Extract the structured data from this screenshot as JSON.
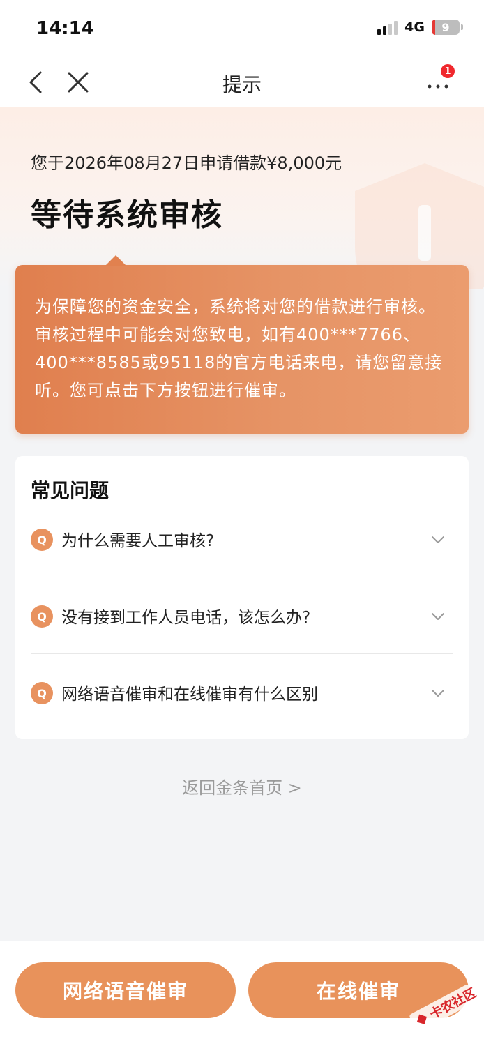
{
  "status_bar": {
    "time": "14:14",
    "network": "4G",
    "battery": "9"
  },
  "nav": {
    "title": "提示",
    "more_badge": "1",
    "icons": [
      "back-icon",
      "close-icon",
      "more-icon"
    ]
  },
  "hero": {
    "subtitle": "您于2026年08月27日申请借款¥8,000元",
    "title": "等待系统审核"
  },
  "notice": {
    "text": "为保障您的资金安全，系统将对您的借款进行审核。审核过程中可能会对您致电，如有400***7766、400***8585或95118的官方电话来电，请您留意接听。您可点击下方按钮进行催审。"
  },
  "faq": {
    "title": "常见问题",
    "q_label": "Q",
    "items": [
      {
        "question": "为什么需要人工审核?"
      },
      {
        "question": "没有接到工作人员电话，该怎么办?"
      },
      {
        "question": "网络语音催审和在线催审有什么区别"
      }
    ]
  },
  "return_link": "返回金条首页 >",
  "buttons": {
    "voice": "网络语音催审",
    "online": "在线催审"
  },
  "watermark": "卡农社区",
  "colors": {
    "accent": "#e8925b",
    "badge": "#f0282d"
  }
}
